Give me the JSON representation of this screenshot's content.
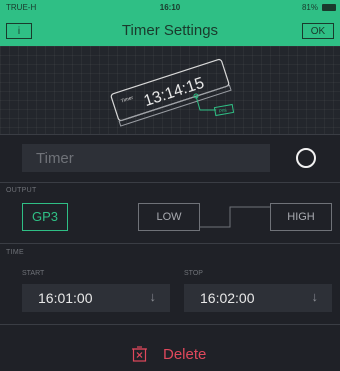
{
  "status_bar": {
    "carrier": "TRUE-H",
    "time": "16:10",
    "battery": "81%"
  },
  "nav": {
    "info_label": "i",
    "title": "Timer Settings",
    "ok_label": "OK"
  },
  "illustration": {
    "device_text": "13:14:15",
    "device_small": "Timer",
    "pin_tag": "PIN"
  },
  "name_field": {
    "placeholder": "Timer"
  },
  "output": {
    "section_label": "OUTPUT",
    "pin": "GP3",
    "low_label": "LOW",
    "high_label": "HIGH"
  },
  "time": {
    "section_label": "TIME",
    "start_label": "START",
    "start_value": "16:01:00",
    "stop_label": "STOP",
    "stop_value": "16:02:00"
  },
  "delete_label": "Delete",
  "colors": {
    "accent": "#2fbf85",
    "background": "#1f2127",
    "field": "#2d3037",
    "danger": "#e0485c"
  }
}
